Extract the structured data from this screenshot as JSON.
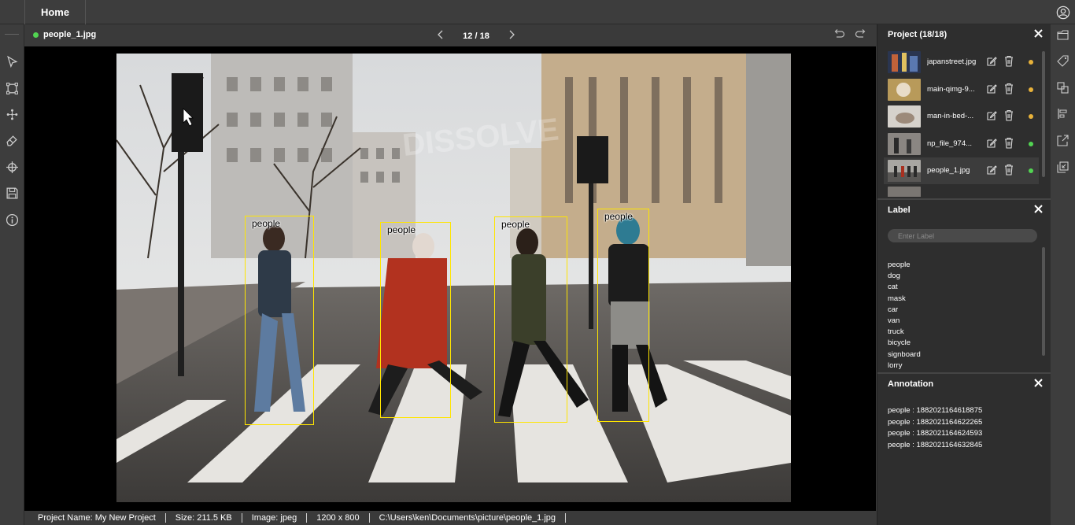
{
  "topbar": {
    "home_label": "Home"
  },
  "header": {
    "file_name": "people_1.jpg",
    "page_indicator": "12 / 18",
    "status_color": "#52d452"
  },
  "canvas": {
    "annotations": [
      {
        "label": "people"
      },
      {
        "label": "people"
      },
      {
        "label": "people"
      },
      {
        "label": "people"
      }
    ],
    "watermark": "DISSOLVE"
  },
  "status_bar": {
    "project_name": "Project Name: My New Project",
    "size": "Size: 211.5 KB",
    "image_type": "Image: jpeg",
    "dimensions": "1200 x 800",
    "path": "C:\\Users\\ken\\Documents\\picture\\people_1.jpg"
  },
  "project_panel": {
    "title": "Project (18/18)",
    "items": [
      {
        "name": "japanstreet.jpg",
        "status_color": "#e8b23a"
      },
      {
        "name": "main-qimg-9...",
        "status_color": "#e8b23a"
      },
      {
        "name": "man-in-bed-...",
        "status_color": "#e8b23a"
      },
      {
        "name": "np_file_974...",
        "status_color": "#52d452"
      },
      {
        "name": "people_1.jpg",
        "status_color": "#52d452"
      }
    ]
  },
  "label_panel": {
    "title": "Label",
    "input_placeholder": "Enter Label",
    "labels": [
      "people",
      "dog",
      "cat",
      "mask",
      "car",
      "van",
      "truck",
      "bicycle",
      "signboard",
      "lorry"
    ]
  },
  "annotation_panel": {
    "title": "Annotation",
    "items": [
      "people : 1882021164618875",
      "people : 1882021164622265",
      "people : 1882021164624593",
      "people : 1882021164632845"
    ]
  },
  "icons": {
    "left_toolbar": [
      "select-cursor-icon",
      "rectangle-tool-icon",
      "polygon-tool-icon",
      "eraser-icon",
      "crosshair-icon",
      "save-icon",
      "info-icon"
    ],
    "right_toolbar": [
      "folder-icon",
      "tag-icon",
      "copy-boxes-icon",
      "align-icon",
      "export-icon",
      "import-icon"
    ]
  },
  "colors": {
    "bbox": "#ffe500",
    "accent_green": "#52d452",
    "accent_orange": "#e8b23a"
  }
}
